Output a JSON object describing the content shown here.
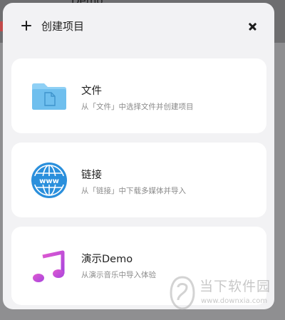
{
  "backdrop": {
    "title": "Demo"
  },
  "dialog": {
    "title": "创建项目",
    "options": [
      {
        "title": "文件",
        "description": "从「文件」中选择文件并创建项目",
        "icon": "folder-icon"
      },
      {
        "title": "链接",
        "description": "从「链接」中下载多媒体并导入",
        "icon": "globe-www-icon"
      },
      {
        "title": "演示Demo",
        "description": "从演示音乐中导入体验",
        "icon": "music-note-icon"
      }
    ]
  },
  "watermark": {
    "name": "当下软件园",
    "url": "www.downxia.com"
  },
  "colors": {
    "folder": "#7ec8f3",
    "globe": "#2a8fdc",
    "music": "#c84fd6",
    "card": "#ffffff",
    "dialog_bg": "#f2f2f4"
  }
}
